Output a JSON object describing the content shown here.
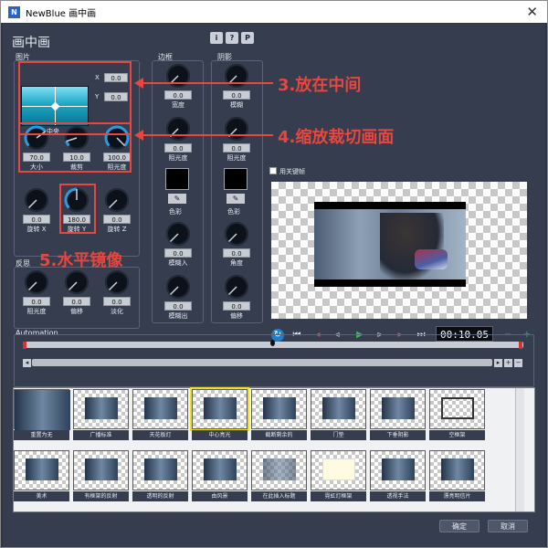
{
  "window": {
    "title": "NewBlue 画中画",
    "icon": "app-icon"
  },
  "page_title": "画中画",
  "top_buttons": [
    "i",
    "?",
    "P"
  ],
  "picture": {
    "group_label": "图片",
    "x_label": "X",
    "x_value": "0.0",
    "y_label": "Y",
    "y_value": "0.0",
    "position_label": "中央",
    "knobs": [
      {
        "value": "70.0",
        "label": "大小"
      },
      {
        "value": "10.0",
        "label": "裁剪"
      },
      {
        "value": "100.0",
        "label": "阻光度"
      },
      {
        "value": "0.0",
        "label": "旋转 X"
      },
      {
        "value": "180.0",
        "label": "旋转 Y"
      },
      {
        "value": "0.0",
        "label": "旋转 Z"
      }
    ]
  },
  "reflection": {
    "group_label": "反思",
    "knobs": [
      {
        "value": "0.0",
        "label": "阻光度"
      },
      {
        "value": "0.0",
        "label": "偏移"
      },
      {
        "value": "0.0",
        "label": "淡化"
      }
    ]
  },
  "border": {
    "group_label": "边框",
    "knobs": [
      {
        "value": "0.0",
        "label": "宽度"
      },
      {
        "value": "0.0",
        "label": "阻光度"
      },
      {
        "value": "0.0",
        "label": "模糊入"
      },
      {
        "value": "0.0",
        "label": "模糊出"
      }
    ],
    "color_label": "色彩"
  },
  "shadow": {
    "group_label": "阴影",
    "knobs": [
      {
        "value": "0.0",
        "label": "模糊"
      },
      {
        "value": "0.0",
        "label": "阻光度"
      },
      {
        "value": "0.0",
        "label": "角度"
      },
      {
        "value": "0.0",
        "label": "偏移"
      }
    ],
    "color_label": "色彩"
  },
  "keyframe_checkbox_label": "用关键帧",
  "timecode": "00:10.05",
  "automation_label": "Automation",
  "annotations": [
    "3.放在中间",
    "4.缩放裁切画面",
    "5.水平镜像"
  ],
  "presets": [
    "重置为无",
    "广播标准",
    "天花板灯",
    "中心亮光",
    "截断剩余的",
    "门垫",
    "下垂阴影",
    "空框架",
    "美术",
    "有框架的反射",
    "透明的反射",
    "由风景",
    "在此插入标题",
    "霓虹灯框架",
    "透视手法",
    "漂亮明信片"
  ],
  "buttons": {
    "ok": "确定",
    "cancel": "取消"
  },
  "colors": {
    "accent_red": "#e8463e",
    "panel": "#353d4f",
    "knob_arc": "#2b9be0"
  }
}
